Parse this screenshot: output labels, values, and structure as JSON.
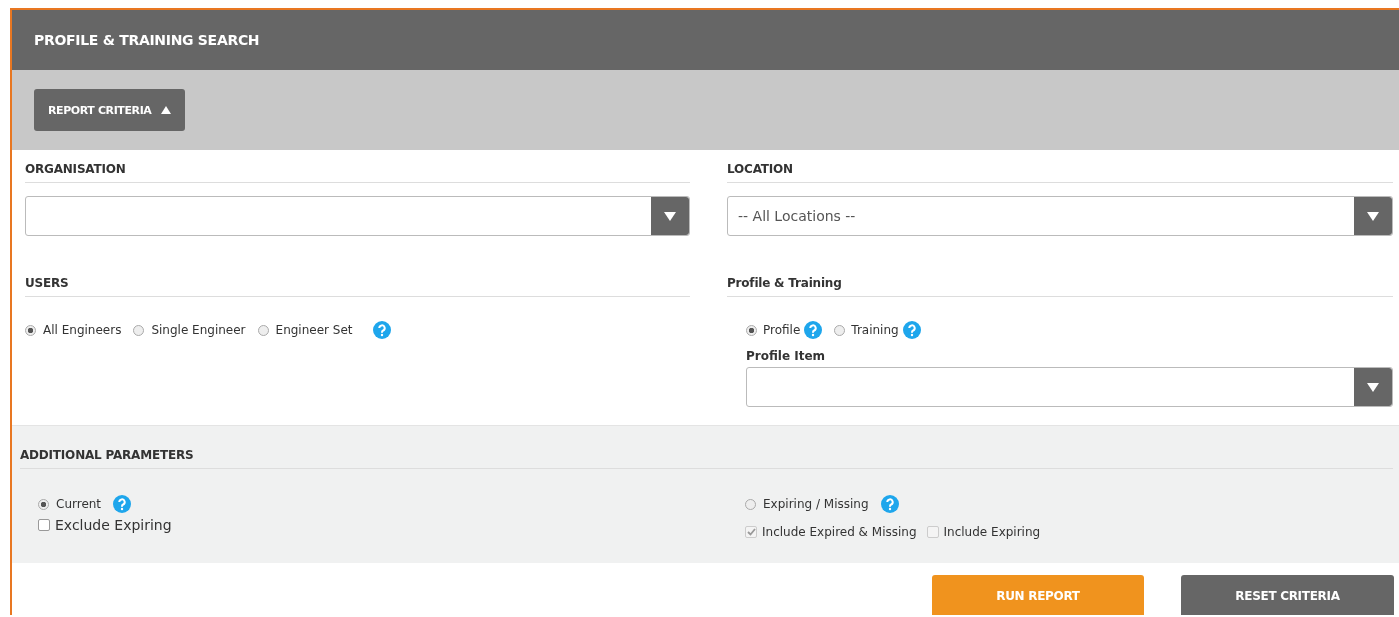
{
  "title": "PROFILE & TRAINING SEARCH",
  "criteria_toggle": {
    "label": "REPORT CRITERIA",
    "expanded": true
  },
  "organisation": {
    "heading": "ORGANISATION"
  },
  "location": {
    "heading": "LOCATION",
    "value": "-- All Locations --"
  },
  "users": {
    "heading": "USERS",
    "options": [
      {
        "label": "All Engineers",
        "selected": true
      },
      {
        "label": "Single Engineer",
        "selected": false
      },
      {
        "label": "Engineer Set",
        "selected": false
      }
    ]
  },
  "profile_training": {
    "heading": "Profile & Training",
    "options": [
      {
        "label": "Profile",
        "selected": true
      },
      {
        "label": "Training",
        "selected": false
      }
    ],
    "item_label": "Profile Item"
  },
  "additional": {
    "heading": "ADDITIONAL PARAMETERS",
    "current": {
      "label": "Current",
      "selected": true
    },
    "exclude_expiring": {
      "label": "Exclude Expiring",
      "checked": false,
      "disabled": false
    },
    "expiring_missing": {
      "label": "Expiring / Missing",
      "selected": false
    },
    "include_expired_missing": {
      "label": "Include Expired & Missing",
      "checked": true,
      "disabled": true
    },
    "include_expiring": {
      "label": "Include Expiring",
      "checked": false,
      "disabled": true
    }
  },
  "buttons": [
    {
      "label": "RUN REPORT",
      "kind": "primary"
    },
    {
      "label": "RESET CRITERIA",
      "kind": "secondary"
    }
  ]
}
